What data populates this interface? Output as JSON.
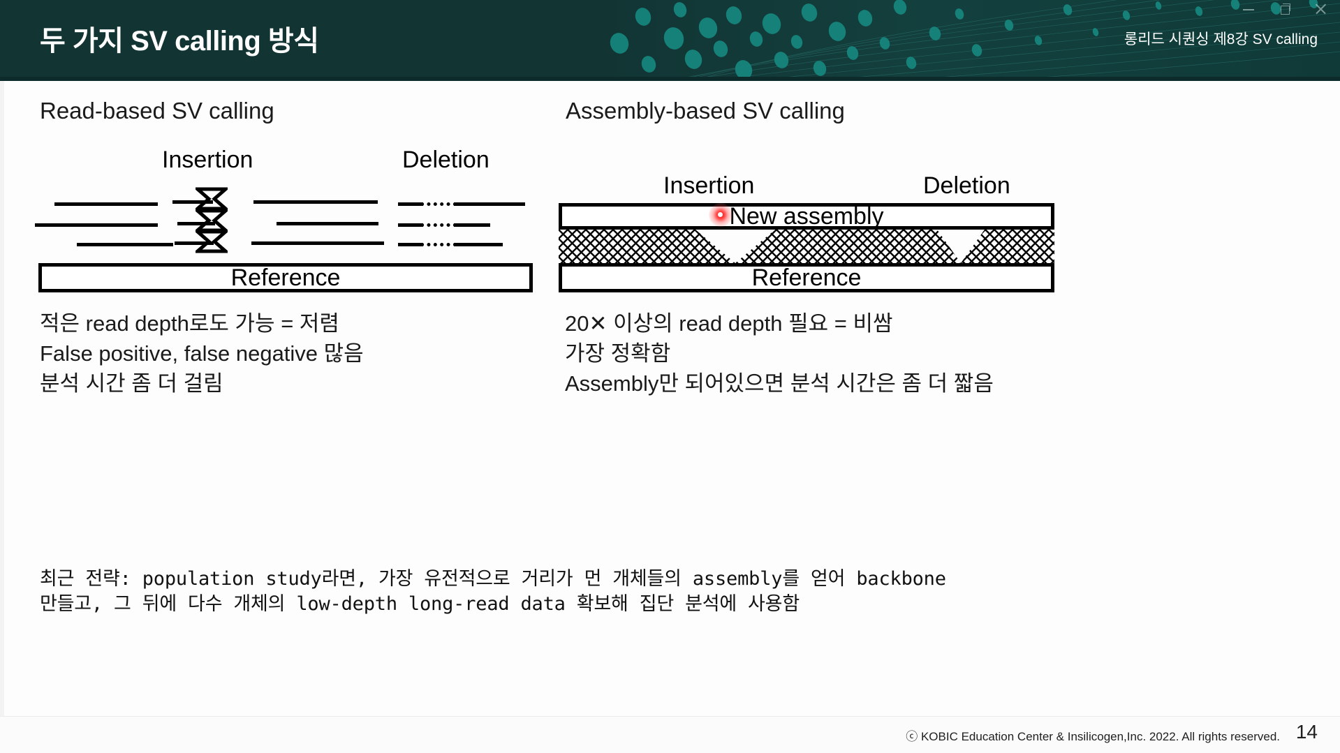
{
  "window": {
    "controls": [
      {
        "name": "minimize",
        "glyph": "minimize-icon"
      },
      {
        "name": "restore",
        "glyph": "restore-icon"
      },
      {
        "name": "close",
        "glyph": "close-icon"
      }
    ]
  },
  "header": {
    "title": "두 가지 SV calling 방식",
    "subtitle": "롱리드 시퀀싱 제8강 SV calling",
    "background_color": "#123534",
    "title_color": "#ffffff"
  },
  "panels": {
    "left": {
      "heading": "Read-based SV calling",
      "diagram": {
        "label_insertion": "Insertion",
        "label_deletion": "Deletion",
        "reference_label": "Reference"
      },
      "bullets": [
        "적은 read depth로도 가능 = 저렴",
        "False positive, false negative 많음",
        "분석 시간 좀 더 걸림"
      ]
    },
    "right": {
      "heading": "Assembly-based SV calling",
      "diagram": {
        "label_insertion": "Insertion",
        "label_deletion": "Deletion",
        "assembly_label": "New assembly",
        "reference_label": "Reference"
      },
      "bullets": [
        "20✕ 이상의 read depth 필요 = 비쌈",
        "가장 정확함",
        "Assembly만 되어있으면 분석 시간은 좀 더 짧음"
      ]
    }
  },
  "strategy": {
    "line1": "최근 전략: population study라면, 가장 유전적으로 거리가 먼 개체들의 assembly를 얻어 backbone",
    "line2": "만들고, 그 뒤에 다수 개체의 low-depth long-read data 확보해 집단 분석에 사용함"
  },
  "cursor": {
    "type": "laser-pointer",
    "color": "#ff0000"
  },
  "footer": {
    "copyright": "ⓒ KOBIC Education Center & Insilicogen,Inc. 2022. All rights reserved.",
    "page_number": "14"
  }
}
